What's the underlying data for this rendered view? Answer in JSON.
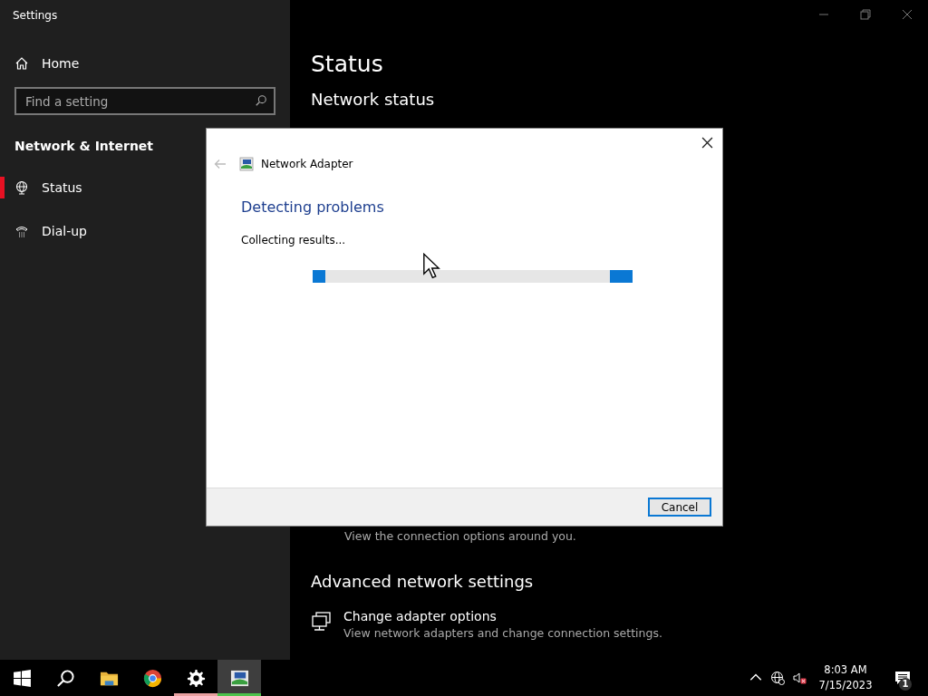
{
  "window": {
    "title": "Settings"
  },
  "sidebar": {
    "home": "Home",
    "search": {
      "placeholder": "Find a setting"
    },
    "section": "Network & Internet",
    "items": [
      {
        "label": "Status",
        "kind": "globe",
        "selected": true
      },
      {
        "label": "Dial-up",
        "kind": "phone",
        "selected": false
      }
    ]
  },
  "content": {
    "title": "Status",
    "heading": "Network status",
    "covered_description": "View the connection options around you.",
    "advanced": {
      "heading": "Advanced network settings",
      "items": [
        {
          "title": "Change adapter options",
          "description": "View network adapters and change connection settings."
        }
      ]
    }
  },
  "dialog": {
    "title": "Network Adapter",
    "heading": "Detecting problems",
    "status": "Collecting results...",
    "progress": {
      "indeterminate": true
    },
    "buttons": [
      {
        "label": "Cancel",
        "default": true
      }
    ]
  },
  "taskbar": {
    "apps": [
      {
        "kind": "start",
        "running": false,
        "selected": false
      },
      {
        "kind": "search",
        "running": false,
        "selected": false
      },
      {
        "kind": "folder",
        "running": false,
        "selected": false
      },
      {
        "kind": "chrome",
        "running": false,
        "selected": false
      },
      {
        "kind": "gear",
        "running": true,
        "selected": false
      },
      {
        "kind": "adapter",
        "running": true,
        "selected": true
      }
    ],
    "time": "8:03 AM",
    "date": "7/15/2023",
    "notifications": "1"
  }
}
